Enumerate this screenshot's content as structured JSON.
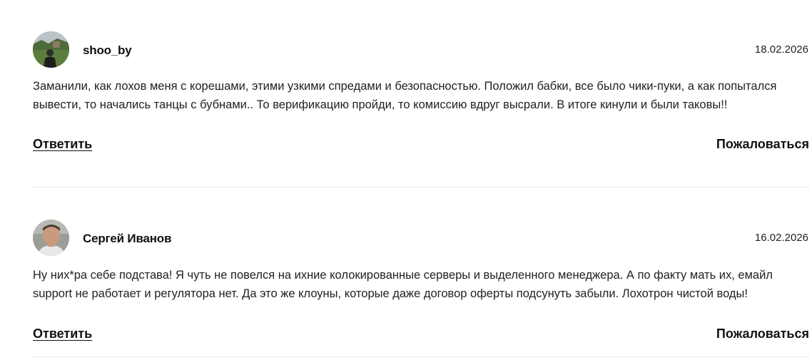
{
  "comments": [
    {
      "author": "shoo_by",
      "date": "18.02.2026",
      "avatar_icon": "user-photo-landscape",
      "text": "Заманили, как лохов меня с корешами, этими узкими спредами и безопасностью. Положил бабки, все было чики-пуки, а как попытался вывести, то начались танцы с бубнами.. То верификацию пройди, то комиссию вдруг высрали. В итоге кинули и были таковы!!",
      "reply_label": "Ответить",
      "report_label": "Пожаловаться"
    },
    {
      "author": "Сергей Иванов",
      "date": "16.02.2026",
      "avatar_icon": "user-photo-portrait",
      "text": "Ну них*ра себе подстава! Я чуть не повелся на ихние колокированные серверы и выделенного менеджера. А по факту мать их, емайл support не работает и регулятора нет. Да это же клоуны, которые даже договор оферты подсунуть забыли. Лохотрон чистой воды!",
      "reply_label": "Ответить",
      "report_label": "Пожаловаться"
    }
  ]
}
